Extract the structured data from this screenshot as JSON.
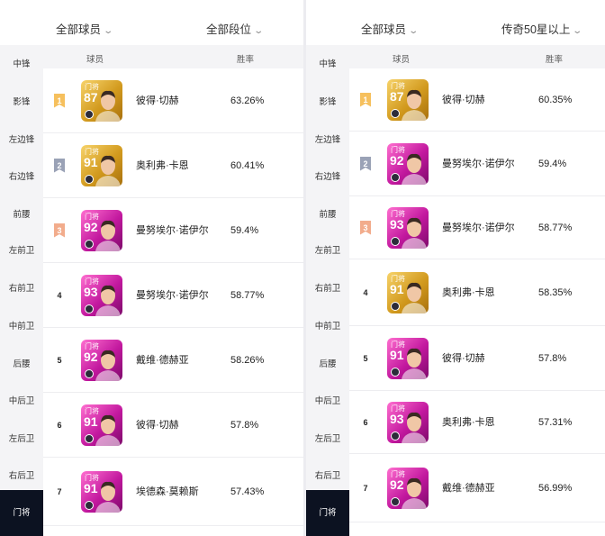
{
  "left": {
    "filters": {
      "player": "全部球员",
      "tier": "全部段位"
    },
    "header": {
      "player": "球员",
      "rate": "胜率"
    },
    "positions": [
      "中锋",
      "影锋",
      "左边锋",
      "右边锋",
      "前腰",
      "左前卫",
      "右前卫",
      "中前卫",
      "后腰",
      "中后卫",
      "左后卫",
      "右后卫",
      "门将"
    ],
    "active_position": "门将",
    "rows": [
      {
        "rank": "1",
        "rank_style": "gold",
        "card_position": "门将",
        "card_rating": "87",
        "card_style": "gold",
        "name": "彼得·切赫",
        "win_rate": "63.26%"
      },
      {
        "rank": "2",
        "rank_style": "silver",
        "card_position": "门将",
        "card_rating": "91",
        "card_style": "gold",
        "name": "奥利弗·卡恩",
        "win_rate": "60.41%"
      },
      {
        "rank": "3",
        "rank_style": "bronze",
        "card_position": "门将",
        "card_rating": "92",
        "card_style": "pink",
        "name": "曼努埃尔·诺伊尔",
        "win_rate": "59.4%"
      },
      {
        "rank": "4",
        "rank_style": "plain",
        "card_position": "门将",
        "card_rating": "93",
        "card_style": "pink",
        "name": "曼努埃尔·诺伊尔",
        "win_rate": "58.77%"
      },
      {
        "rank": "5",
        "rank_style": "plain",
        "card_position": "门将",
        "card_rating": "92",
        "card_style": "pink",
        "name": "戴维·德赫亚",
        "win_rate": "58.26%"
      },
      {
        "rank": "6",
        "rank_style": "plain",
        "card_position": "门将",
        "card_rating": "91",
        "card_style": "pink",
        "name": "彼得·切赫",
        "win_rate": "57.8%"
      },
      {
        "rank": "7",
        "rank_style": "plain",
        "card_position": "门将",
        "card_rating": "91",
        "card_style": "pink",
        "name": "埃德森·莫赖斯",
        "win_rate": "57.43%"
      }
    ]
  },
  "right": {
    "filters": {
      "player": "全部球员",
      "tier": "传奇50星以上"
    },
    "header": {
      "player": "球员",
      "rate": "胜率"
    },
    "positions": [
      "中锋",
      "影锋",
      "左边锋",
      "右边锋",
      "前腰",
      "左前卫",
      "右前卫",
      "中前卫",
      "后腰",
      "中后卫",
      "左后卫",
      "右后卫",
      "门将"
    ],
    "active_position": "门将",
    "rows": [
      {
        "rank": "1",
        "rank_style": "gold",
        "card_position": "门将",
        "card_rating": "87",
        "card_style": "gold",
        "name": "彼得·切赫",
        "win_rate": "60.35%"
      },
      {
        "rank": "2",
        "rank_style": "silver",
        "card_position": "门将",
        "card_rating": "92",
        "card_style": "pink",
        "name": "曼努埃尔·诺伊尔",
        "win_rate": "59.4%"
      },
      {
        "rank": "3",
        "rank_style": "bronze",
        "card_position": "门将",
        "card_rating": "93",
        "card_style": "pink",
        "name": "曼努埃尔·诺伊尔",
        "win_rate": "58.77%"
      },
      {
        "rank": "4",
        "rank_style": "plain",
        "card_position": "门将",
        "card_rating": "91",
        "card_style": "gold",
        "name": "奥利弗·卡恩",
        "win_rate": "58.35%"
      },
      {
        "rank": "5",
        "rank_style": "plain",
        "card_position": "门将",
        "card_rating": "91",
        "card_style": "pink",
        "name": "彼得·切赫",
        "win_rate": "57.8%"
      },
      {
        "rank": "6",
        "rank_style": "plain",
        "card_position": "门将",
        "card_rating": "93",
        "card_style": "pink",
        "name": "奥利弗·卡恩",
        "win_rate": "57.31%"
      },
      {
        "rank": "7",
        "rank_style": "plain",
        "card_position": "门将",
        "card_rating": "92",
        "card_style": "pink",
        "name": "戴维·德赫亚",
        "win_rate": "56.99%"
      }
    ]
  },
  "icons": {
    "filter_dropdown": "chevron-down-icon",
    "rank_marker": "ribbon-icon",
    "card_badge": "club-badge-icon"
  },
  "colors": {
    "gold_card": "#d29a1e",
    "pink_card": "#c2189e",
    "active_position_bg": "#0c1221",
    "rank_gold": "#f6c05d",
    "rank_silver": "#9aa2b6",
    "rank_bronze": "#f2ac8c"
  }
}
